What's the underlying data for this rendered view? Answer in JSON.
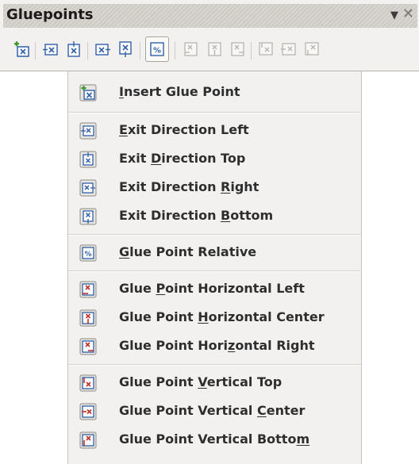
{
  "toolbar": {
    "title": "Gluepoints",
    "menu_arrow": "▼",
    "close": "✕"
  },
  "menu": {
    "items": [
      {
        "label": "Insert Glue Point",
        "mnemonic": "I",
        "icon": "insert-glue-point-icon"
      },
      {
        "label": "Exit Direction Left",
        "mnemonic": "E",
        "icon": "exit-direction-left-icon"
      },
      {
        "label": "Exit Direction Top",
        "mnemonic": "D",
        "icon": "exit-direction-top-icon"
      },
      {
        "label": "Exit Direction Right",
        "mnemonic": "R",
        "icon": "exit-direction-right-icon"
      },
      {
        "label": "Exit Direction Bottom",
        "mnemonic": "B",
        "icon": "exit-direction-bottom-icon"
      },
      {
        "label": "Glue Point Relative",
        "mnemonic": "G",
        "icon": "glue-point-relative-icon"
      },
      {
        "label": "Glue Point Horizontal Left",
        "mnemonic": "P",
        "icon": "glue-point-horizontal-left-icon"
      },
      {
        "label": "Glue Point Horizontal Center",
        "mnemonic": "H",
        "icon": "glue-point-horizontal-center-icon"
      },
      {
        "label": "Glue Point Horizontal Right",
        "mnemonic": "z",
        "icon": "glue-point-horizontal-right-icon"
      },
      {
        "label": "Glue Point Vertical Top",
        "mnemonic": "V",
        "icon": "glue-point-vertical-top-icon"
      },
      {
        "label": "Glue Point Vertical Center",
        "mnemonic": "C",
        "icon": "glue-point-vertical-center-icon"
      },
      {
        "label": "Glue Point Vertical Bottom",
        "mnemonic": "m",
        "icon": "glue-point-vertical-bottom-icon"
      }
    ]
  },
  "colors": {
    "icon_blue": "#2f5fa8",
    "icon_red": "#c0302a",
    "icon_green": "#3f9a2f",
    "disabled": "#b8b5b0"
  }
}
